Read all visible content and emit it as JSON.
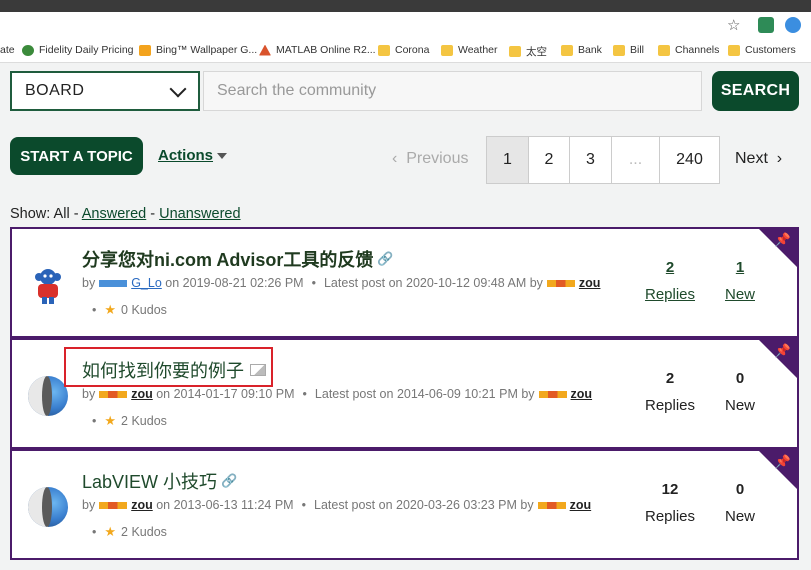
{
  "browser": {
    "bookmarks": [
      {
        "label": "ate",
        "icon": "none"
      },
      {
        "label": "Fidelity Daily Pricing",
        "icon": "fidelity-icon"
      },
      {
        "label": "Bing™ Wallpaper G...",
        "icon": "bing-icon"
      },
      {
        "label": "MATLAB Online R2...",
        "icon": "matlab-icon"
      },
      {
        "label": "Corona",
        "icon": "folder-icon"
      },
      {
        "label": "Weather",
        "icon": "folder-icon"
      },
      {
        "label": "太空",
        "icon": "folder-icon"
      },
      {
        "label": "Bank",
        "icon": "folder-icon"
      },
      {
        "label": "Bill",
        "icon": "folder-icon"
      },
      {
        "label": "Channels",
        "icon": "folder-icon"
      },
      {
        "label": "Customers",
        "icon": "folder-icon"
      }
    ]
  },
  "search": {
    "board_label": "BOARD",
    "placeholder": "Search the community",
    "button_label": "SEARCH"
  },
  "toolbar": {
    "start_topic_label": "START A TOPIC",
    "actions_label": "Actions"
  },
  "pagination": {
    "previous_label": "Previous",
    "pages": [
      "1",
      "2",
      "3",
      "...",
      "240"
    ],
    "current_page": "1",
    "next_label": "Next"
  },
  "filter": {
    "show_label": "Show:",
    "all_label": "All",
    "answered_label": "Answered",
    "unanswered_label": "Unanswered"
  },
  "topics": [
    {
      "title": "分享您对ni.com Advisor工具的反馈",
      "by": "by",
      "author": "G_Lo",
      "on_label": "on",
      "posted": "2019-08-21 02:26 PM",
      "latest_label": "Latest post on",
      "latest": "2020-10-12 09:48 AM",
      "latest_by": "by",
      "latest_author": "zou",
      "kudos": "0 Kudos",
      "replies": "2",
      "replies_label": "Replies",
      "new": "1",
      "new_label": "New"
    },
    {
      "title": "如何找到你要的例子",
      "by": "by",
      "author": "zou",
      "on_label": "on",
      "posted": "2014-01-17 09:10 PM",
      "latest_label": "Latest post on",
      "latest": "2014-06-09 10:21 PM",
      "latest_by": "by",
      "latest_author": "zou",
      "kudos": "2 Kudos",
      "replies": "2",
      "replies_label": "Replies",
      "new": "0",
      "new_label": "New"
    },
    {
      "title": "LabVIEW 小技巧",
      "by": "by",
      "author": "zou",
      "on_label": "on",
      "posted": "2013-06-13 11:24 PM",
      "latest_label": "Latest post on",
      "latest": "2020-03-26 03:23 PM",
      "latest_by": "by",
      "latest_author": "zou",
      "kudos": "2 Kudos",
      "replies": "12",
      "replies_label": "Replies",
      "new": "0",
      "new_label": "New"
    }
  ],
  "colors": {
    "brand_green": "#0b4a2c",
    "card_border": "#4b1b6a",
    "highlight_red": "#d9222a"
  }
}
